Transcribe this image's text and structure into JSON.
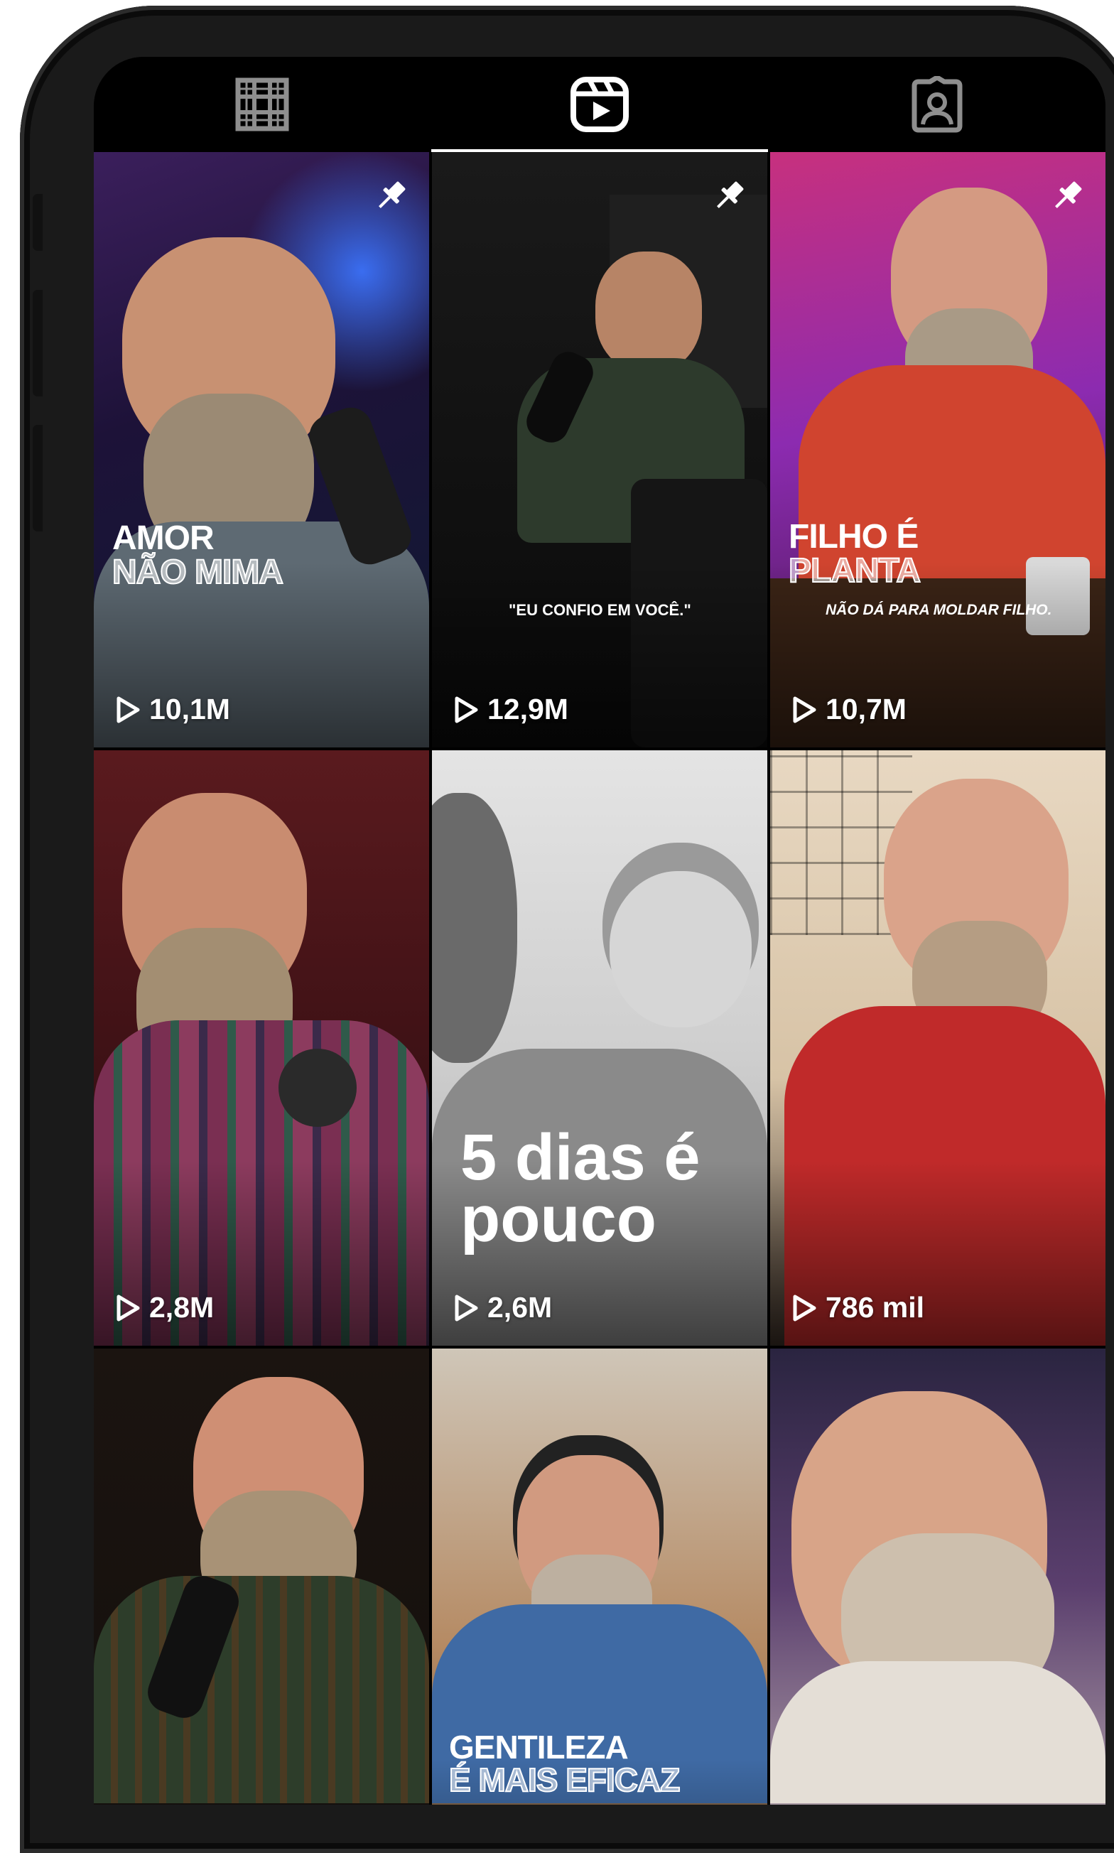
{
  "tabs": [
    {
      "icon": "grid-icon",
      "active": false
    },
    {
      "icon": "reels-icon",
      "active": true
    },
    {
      "icon": "tagged-icon",
      "active": false
    }
  ],
  "reels": [
    {
      "views": "10,1M",
      "pinned": true,
      "caption_line1": "AMOR",
      "caption_line2": "NÃO MIMA"
    },
    {
      "views": "12,9M",
      "pinned": true,
      "caption_quote": "\"EU CONFIO EM VOCÊ.\""
    },
    {
      "views": "10,7M",
      "pinned": true,
      "caption_line1": "FILHO É",
      "caption_line2": "PLANTA",
      "caption_sub": "NÃO DÁ PARA MOLDAR FILHO."
    },
    {
      "views": "2,8M",
      "pinned": false
    },
    {
      "views": "2,6M",
      "pinned": false,
      "caption_text": "5 dias é pouco"
    },
    {
      "views": "786 mil",
      "pinned": false
    },
    {
      "views": "",
      "pinned": false
    },
    {
      "views": "",
      "pinned": false,
      "caption_line1": "GENTILEZA",
      "caption_line2": "É MAIS EFICAZ"
    },
    {
      "views": "",
      "pinned": false
    }
  ],
  "colors": {
    "background": "#000000",
    "text": "#ffffff",
    "frame": "#1a1a1a"
  }
}
